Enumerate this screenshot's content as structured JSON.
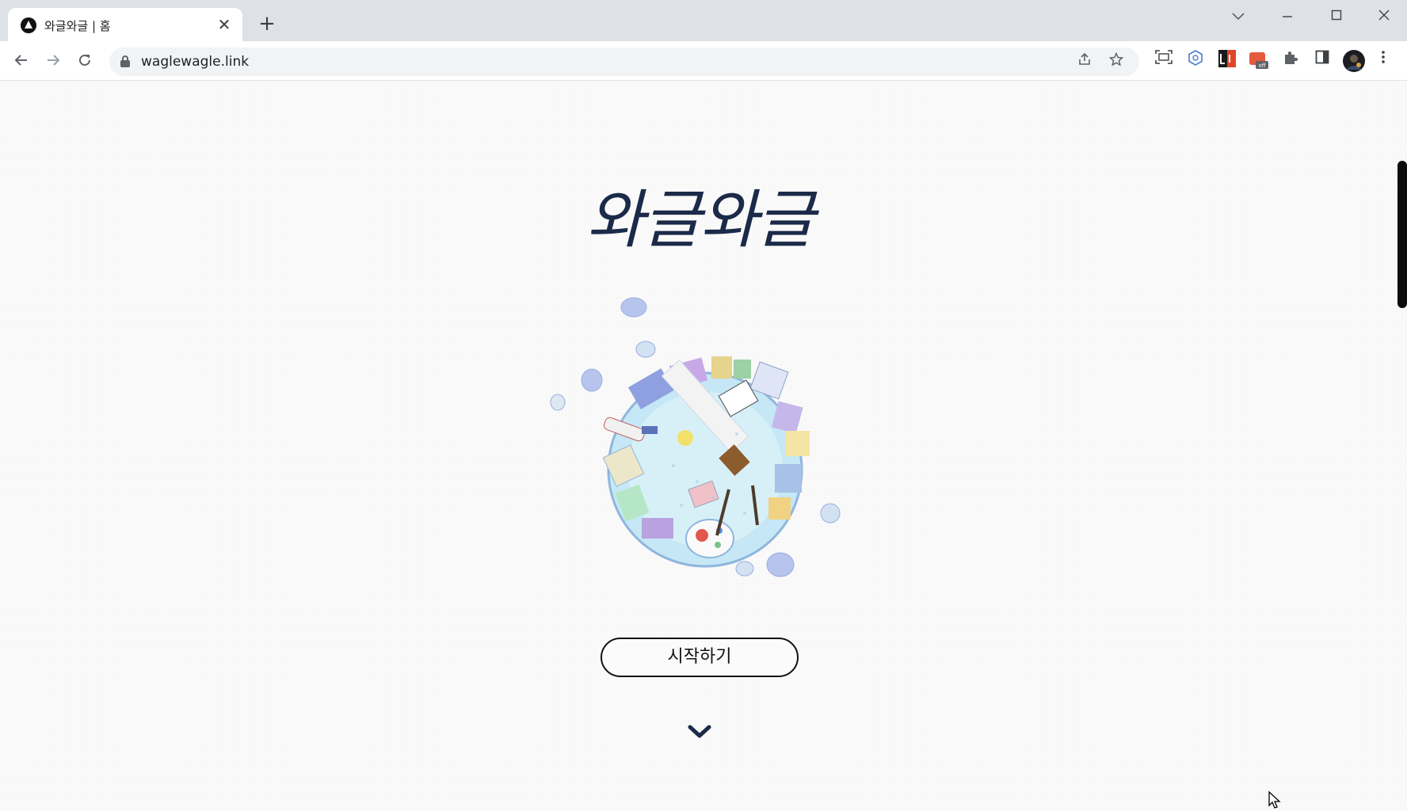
{
  "browser": {
    "tab": {
      "title": "와글와글 | 홈",
      "favicon": "triangle-logo-icon",
      "close_label": "✕"
    },
    "new_tab_label": "+",
    "window_controls": {
      "dropdown": "⌄",
      "minimize": "─",
      "maximize": "▢",
      "close": "✕"
    },
    "nav": {
      "back": "←",
      "forward": "→",
      "reload": "↻"
    },
    "address": {
      "url": "waglewagle.link"
    },
    "extension_badge": "off"
  },
  "page": {
    "title": "와글와글",
    "start_button_label": "시작하기",
    "illustration": "globe-illustration",
    "scroll_indicator": "chevron-down-icon"
  },
  "colors": {
    "title": "#1b2a49",
    "page_bg": "#fafafa",
    "button_border": "#111111"
  }
}
